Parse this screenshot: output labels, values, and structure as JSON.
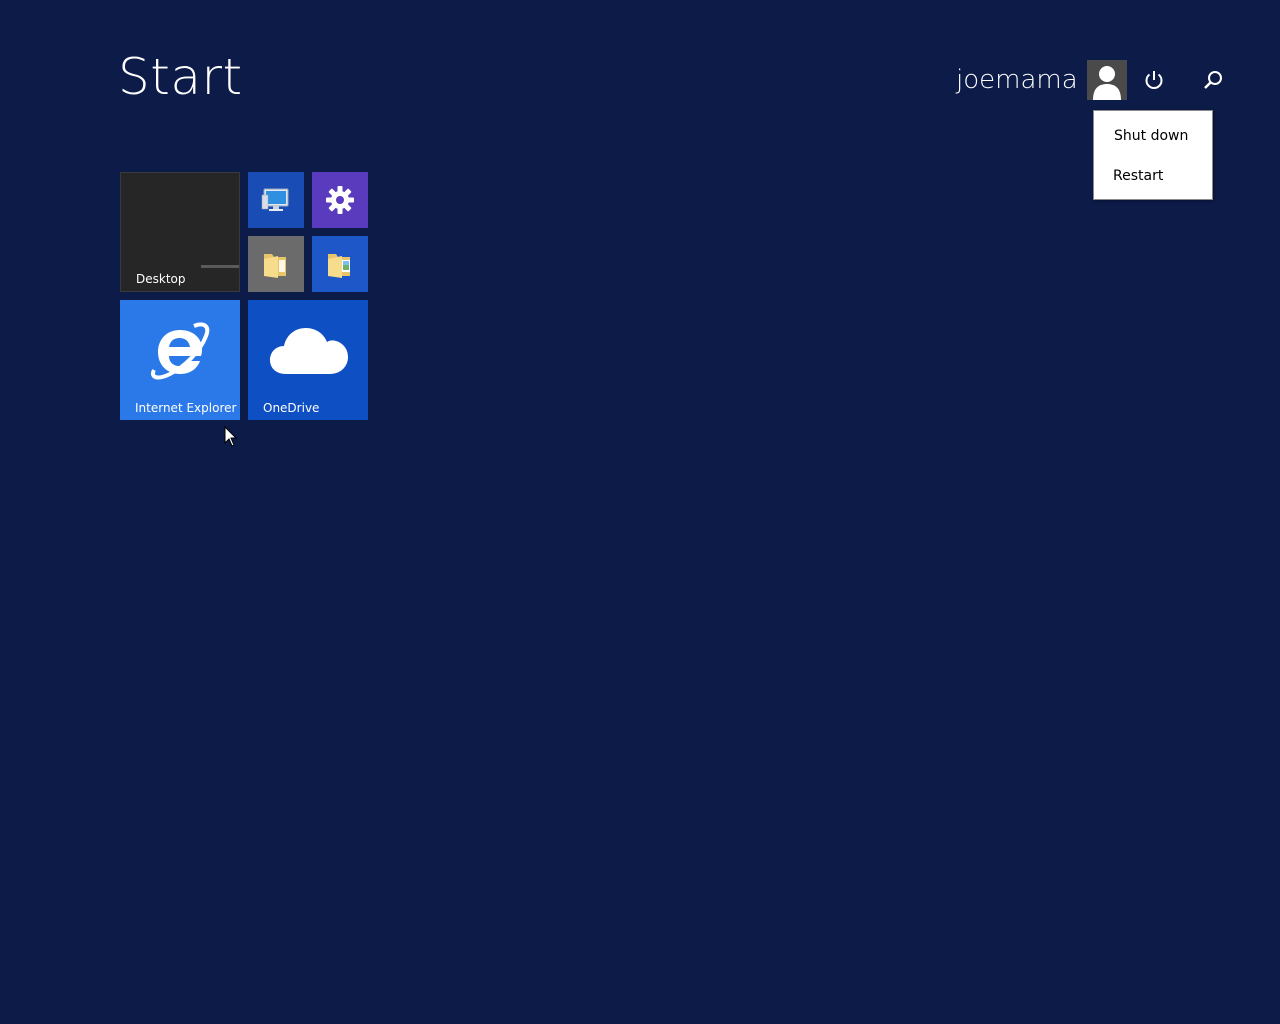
{
  "header": {
    "title": "Start",
    "user_name": "joemama",
    "avatar_icon": "user-avatar-icon",
    "power_icon": "power-icon",
    "search_icon": "search-icon"
  },
  "power_menu": {
    "items": [
      {
        "label": "Shut down"
      },
      {
        "label": "Restart"
      }
    ]
  },
  "tiles": {
    "desktop": {
      "label": "Desktop",
      "color": "#262626"
    },
    "computer": {
      "icon": "computer-monitor-icon",
      "color": "#1a4cb5"
    },
    "settings": {
      "icon": "gear-icon",
      "color": "#5a3bbd"
    },
    "folder1": {
      "icon": "folder-icon",
      "color": "#6b6b6b"
    },
    "folder2": {
      "icon": "folder-image-icon",
      "color": "#1e58c8"
    },
    "internet_explorer": {
      "label": "Internet Explorer",
      "icon": "internet-explorer-icon",
      "color": "#2b79e8"
    },
    "onedrive": {
      "label": "OneDrive",
      "icon": "cloud-icon",
      "color": "#0f4fc4"
    }
  },
  "colors": {
    "background": "#0c1b47",
    "menu_background": "#ffffff"
  }
}
